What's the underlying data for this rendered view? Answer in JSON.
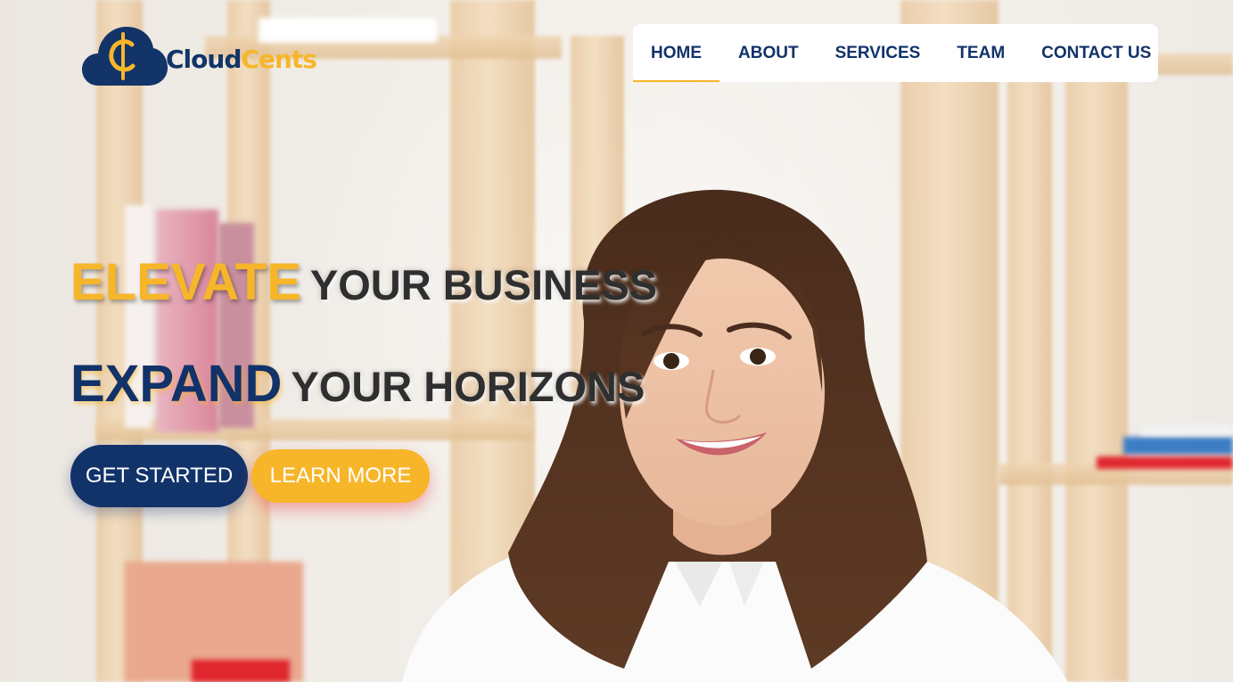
{
  "brand": {
    "name_part1": "Cloud",
    "name_part2": "Cents",
    "logo_icon": "cloud-cent-icon",
    "colors": {
      "navy": "#12326a",
      "gold": "#f7b62a"
    }
  },
  "nav": {
    "items": [
      {
        "label": "HOME",
        "active": true
      },
      {
        "label": "ABOUT",
        "active": false
      },
      {
        "label": "SERVICES",
        "active": false
      },
      {
        "label": "TEAM",
        "active": false
      },
      {
        "label": "CONTACT US",
        "active": false
      }
    ]
  },
  "hero": {
    "line1": {
      "accent": "ELEVATE",
      "rest": "YOUR BUSINESS"
    },
    "line2": {
      "accent": "EXPAND",
      "rest": "YOUR HORIZONS"
    },
    "primary_cta": "GET STARTED",
    "secondary_cta": "LEARN MORE"
  }
}
